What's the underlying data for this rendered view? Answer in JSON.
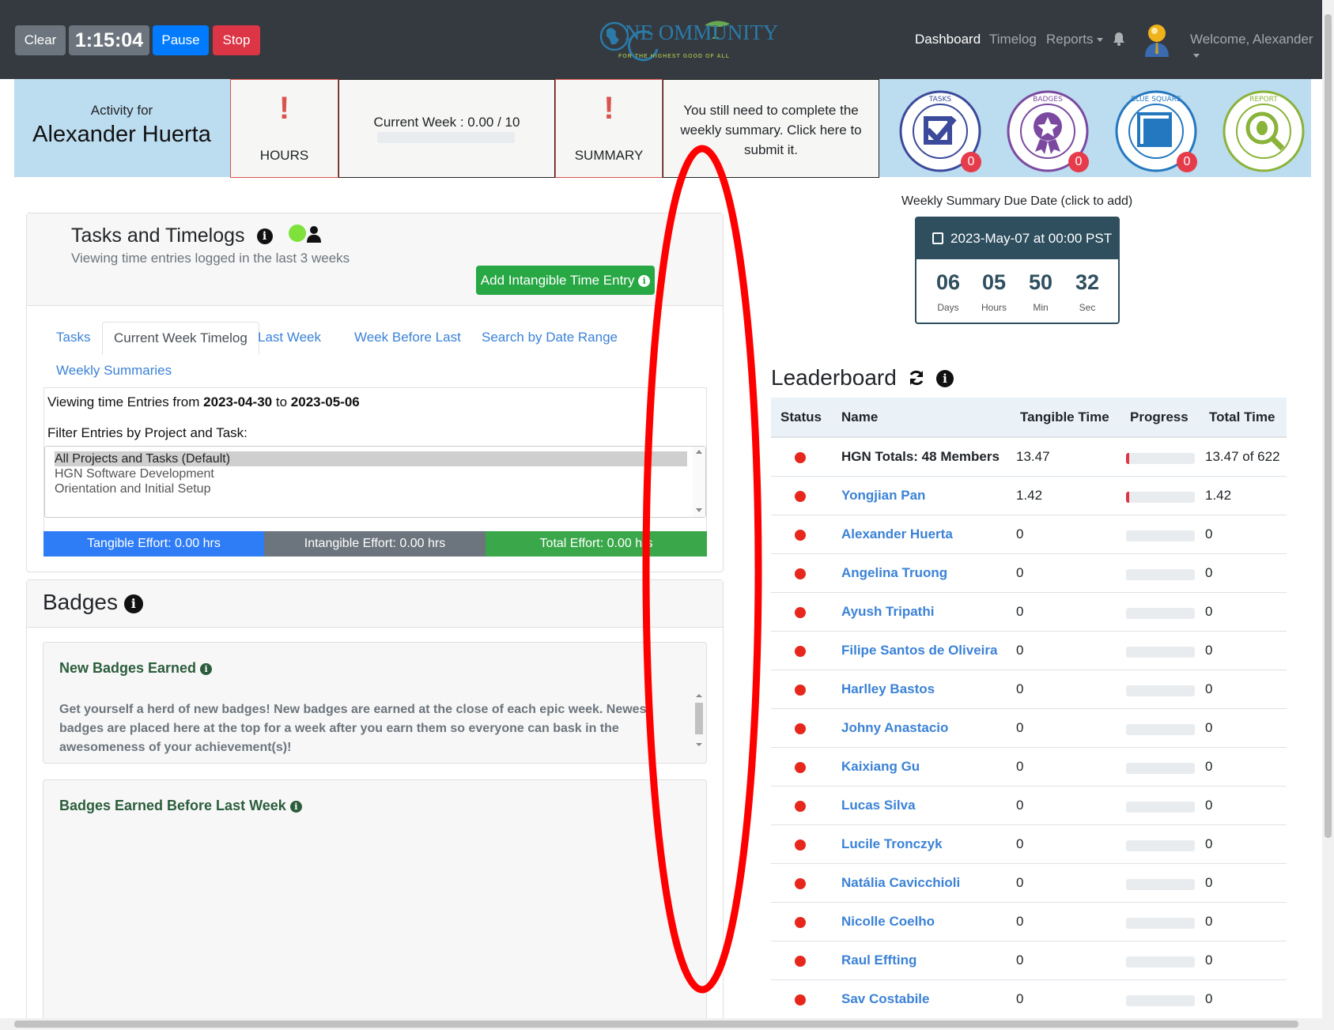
{
  "toolbar": {
    "clear": "Clear",
    "timer": "1:15:04",
    "pause": "Pause",
    "stop": "Stop"
  },
  "logo": {
    "text": "NE OMMUNITY",
    "tagline": "FOR THE HIGHEST GOOD OF ALL"
  },
  "nav": {
    "dashboard": "Dashboard",
    "timelog": "Timelog",
    "reports": "Reports",
    "welcome": "Welcome, Alexander"
  },
  "status": {
    "activity_for": "Activity for",
    "name": "Alexander Huerta",
    "hours_mark": "!",
    "hours_label": "HOURS",
    "current_week": "Current Week : 0.00 / 10",
    "current_week_progress": 0,
    "summary_mark": "!",
    "summary_label": "SUMMARY",
    "summary_note": "You still need to complete the weekly summary. Click here to submit it.",
    "badges": [
      {
        "icon": "tasks-criteria-badge-icon",
        "count": "0"
      },
      {
        "icon": "badges-earned-icon",
        "count": "0"
      },
      {
        "icon": "blue-square-record-icon",
        "count": "0"
      },
      {
        "icon": "report-app-bug-icon",
        "count": ""
      }
    ]
  },
  "tasks_panel": {
    "title": "Tasks and Timelogs",
    "subtitle": "Viewing time entries logged in the last 3 weeks",
    "add_button": "Add Intangible Time Entry",
    "tabs": [
      "Tasks",
      "Current Week Timelog",
      "Last Week",
      "Week Before Last",
      "Search by Date Range",
      "Weekly Summaries"
    ],
    "viewing_prefix": "Viewing time Entries from",
    "date_from": "2023-04-30",
    "viewing_to": "to",
    "date_to": "2023-05-06",
    "filter_label": "Filter Entries by Project and Task:",
    "options": [
      "All Projects and Tasks (Default)",
      "HGN Software Development",
      "Orientation and Initial Setup"
    ],
    "tangible": "Tangible Effort: 0.00 hrs",
    "intangible": "Intangible Effort: 0.00 hrs",
    "total": "Total Effort: 0.00 hrs"
  },
  "badges_panel": {
    "title": "Badges",
    "new_title": "New Badges Earned",
    "new_text": "Get yourself a herd of new badges! New badges are earned at the close of each epic week. Newest badges are placed here at the top for a week after you earn them so everyone can bask in the awesomeness of your achievement(s)!",
    "before_title": "Badges Earned Before Last Week"
  },
  "weekly_summary": {
    "due_label": "Weekly Summary Due Date (click to add)",
    "due_date": "2023-May-07 at 00:00 PST",
    "days": "06",
    "hours": "05",
    "min": "50",
    "sec": "32",
    "days_label": "Days",
    "hours_label": "Hours",
    "min_label": "Min",
    "sec_label": "Sec"
  },
  "leaderboard": {
    "title": "Leaderboard",
    "columns": [
      "Status",
      "Name",
      "Tangible Time",
      "Progress",
      "Total Time"
    ],
    "rows": [
      {
        "name": "HGN Totals: 48 Members",
        "tangible": "13.47",
        "progress": 0.05,
        "total": "13.47 of 622"
      },
      {
        "name": "Yongjian Pan",
        "tangible": "1.42",
        "progress": 0.05,
        "total": "1.42"
      },
      {
        "name": "Alexander Huerta",
        "tangible": "0",
        "progress": 0,
        "total": "0"
      },
      {
        "name": "Angelina Truong",
        "tangible": "0",
        "progress": 0,
        "total": "0"
      },
      {
        "name": "Ayush Tripathi",
        "tangible": "0",
        "progress": 0,
        "total": "0"
      },
      {
        "name": "Filipe Santos de Oliveira",
        "tangible": "0",
        "progress": 0,
        "total": "0"
      },
      {
        "name": "Harlley Bastos",
        "tangible": "0",
        "progress": 0,
        "total": "0"
      },
      {
        "name": "Johny Anastacio",
        "tangible": "0",
        "progress": 0,
        "total": "0"
      },
      {
        "name": "Kaixiang Gu",
        "tangible": "0",
        "progress": 0,
        "total": "0"
      },
      {
        "name": "Lucas Silva",
        "tangible": "0",
        "progress": 0,
        "total": "0"
      },
      {
        "name": "Lucile Tronczyk",
        "tangible": "0",
        "progress": 0,
        "total": "0"
      },
      {
        "name": "Natália Cavicchioli",
        "tangible": "0",
        "progress": 0,
        "total": "0"
      },
      {
        "name": "Nicolle Coelho",
        "tangible": "0",
        "progress": 0,
        "total": "0"
      },
      {
        "name": "Raul Effting",
        "tangible": "0",
        "progress": 0,
        "total": "0"
      },
      {
        "name": "Sav Costabile",
        "tangible": "0",
        "progress": 0,
        "total": "0"
      }
    ]
  },
  "colors": {
    "navbar": "#343a40",
    "band": "#bcdcef",
    "link": "#3b82d6",
    "status_dot": "#e8271c",
    "annotation": "#ff0000"
  }
}
